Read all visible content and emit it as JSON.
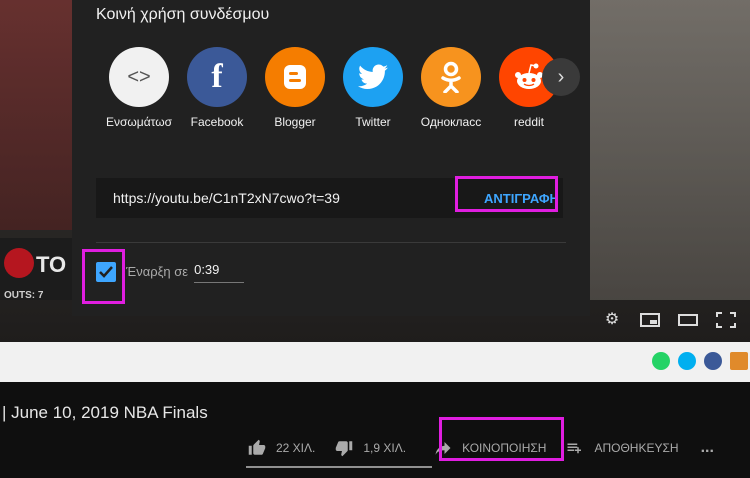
{
  "dialog": {
    "title": "Κοινή χρήση συνδέσμου",
    "services": [
      {
        "label": "Ενσωμάτωσ",
        "icon": "embed-icon",
        "color": "#f1f1f1",
        "glyph": "<>"
      },
      {
        "label": "Facebook",
        "icon": "facebook-icon",
        "color": "#3b5998",
        "glyph": "f"
      },
      {
        "label": "Blogger",
        "icon": "blogger-icon",
        "color": "#f57d00",
        "glyph": "B"
      },
      {
        "label": "Twitter",
        "icon": "twitter-icon",
        "color": "#1da1f2",
        "glyph": "t"
      },
      {
        "label": "Однокласс",
        "icon": "odnoklassniki-icon",
        "color": "#f7931e",
        "glyph": "ok"
      },
      {
        "label": "reddit",
        "icon": "reddit-icon",
        "color": "#ff4500",
        "glyph": "r"
      }
    ],
    "next_icon": "chevron-right-icon",
    "link": "https://youtu.be/C1nT2xN7cwo?t=39",
    "copy_label": "ΑΝΤΙΓΡΑΦΗ",
    "start_at_label": "Έναρξη σε",
    "start_at_value": "0:39",
    "start_checked": true
  },
  "video": {
    "scorebug_text": "TO",
    "scorebug_sub": "OUTS: 7"
  },
  "title": "| June 10, 2019 NBA Finals",
  "actions": {
    "likes": "22 ΧΙΛ.",
    "dislikes": "1,9 ΧΙΛ.",
    "share": "ΚΟΙΝΟΠΟΙΗΣΗ",
    "save": "ΑΠΟΘΗΚΕΥΣΗ",
    "more": "..."
  },
  "colors": {
    "accent": "#3ea6ff",
    "highlight": "#e01ee0",
    "dialog_bg": "#212121"
  }
}
